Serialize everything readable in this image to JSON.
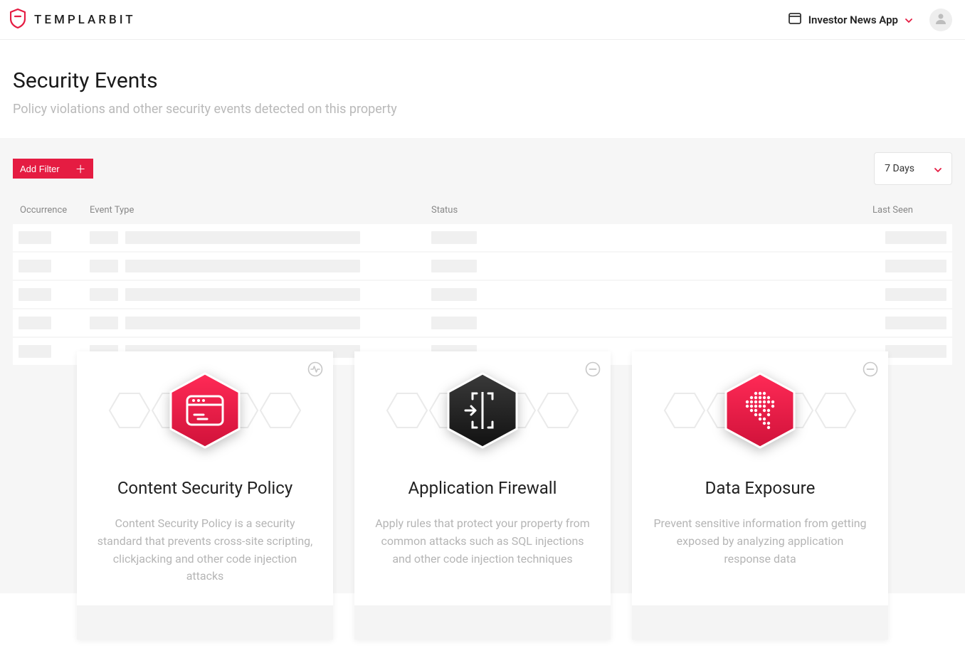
{
  "brand": {
    "name": "TEMPLARBIT"
  },
  "appSwitcher": {
    "label": "Investor News App"
  },
  "page": {
    "title": "Security Events",
    "subtitle": "Policy violations and other security events detected on this property"
  },
  "controls": {
    "addFilterLabel": "Add Filter",
    "rangeLabel": "7 Days"
  },
  "table": {
    "columns": {
      "occurrence": "Occurrence",
      "eventType": "Event Type",
      "status": "Status",
      "lastSeen": "Last Seen"
    },
    "rows": [
      {
        "loading": true
      },
      {
        "loading": true
      },
      {
        "loading": true
      },
      {
        "loading": true
      },
      {
        "loading": true
      }
    ]
  },
  "cards": [
    {
      "title": "Content Security Policy",
      "desc": "Content Security Policy is a security standard that prevents cross-site scripting, clickjacking and other code injection attacks",
      "statusIcon": "activity",
      "hexColor": "#e51c42",
      "iconType": "browser"
    },
    {
      "title": "Application Firewall",
      "desc": "Apply rules that protect your property from common attacks such as SQL injections and other code injection techniques",
      "statusIcon": "minus",
      "hexColor": "#232323",
      "iconType": "firewall"
    },
    {
      "title": "Data Exposure",
      "desc": "Prevent sensitive information from getting exposed by analyzing application response data",
      "statusIcon": "minus",
      "hexColor": "#e51c42",
      "iconType": "dots"
    }
  ]
}
